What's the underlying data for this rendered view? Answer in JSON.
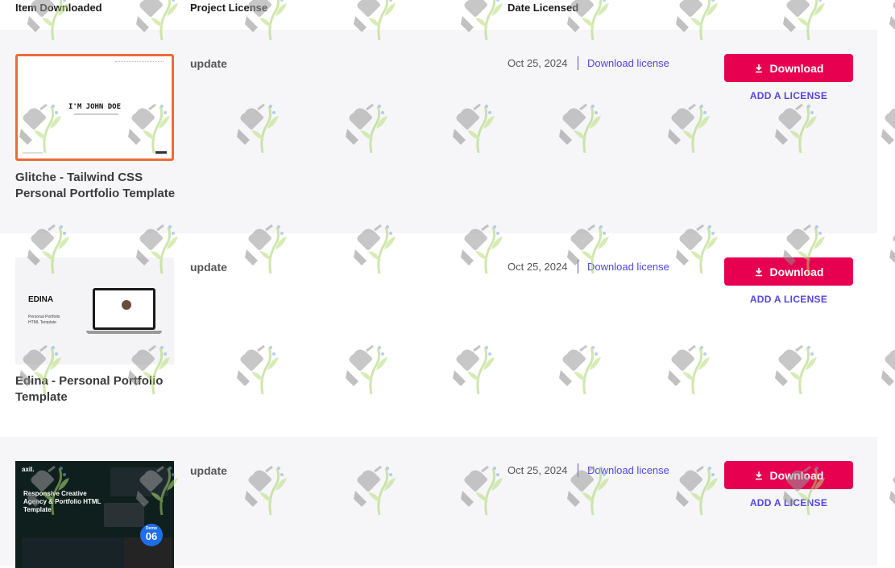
{
  "table": {
    "headers": {
      "item": "Item Downloaded",
      "project_license": "Project License",
      "date_licensed": "Date Licensed"
    }
  },
  "rows": [
    {
      "title": "Glitche - Tailwind CSS Personal Portfolio Template",
      "license_type": "update",
      "date": "Oct 25, 2024",
      "download_license_label": "Download license",
      "download_button_label": "Download",
      "add_license_label": "ADD A LICENSE",
      "thumbnail_text": "I'M JOHN DOE"
    },
    {
      "title": "Edina - Personal Portfolio Template",
      "license_type": "update",
      "date": "Oct 25, 2024",
      "download_license_label": "Download license",
      "download_button_label": "Download",
      "add_license_label": "ADD A LICENSE",
      "thumbnail_brand": "EDINA",
      "thumbnail_lines": [
        "Personal Portfolio",
        "HTML Template"
      ]
    },
    {
      "title": "",
      "license_type": "update",
      "date": "Oct 25, 2024",
      "download_license_label": "Download license",
      "download_button_label": "Download",
      "add_license_label": "ADD A LICENSE",
      "thumbnail_logo": "axil.",
      "thumbnail_heading": "Responsive Creative Agency & Portfolio HTML Template",
      "thumbnail_badge_number": "06",
      "thumbnail_badge_label": "Demo"
    }
  ],
  "colors": {
    "accent": "#e6004f",
    "link": "#4f46e5",
    "selected_border": "#ef6a3a",
    "row_shade": "#f6f6f9"
  },
  "icons": [
    "download-icon",
    "watermark-icon"
  ]
}
